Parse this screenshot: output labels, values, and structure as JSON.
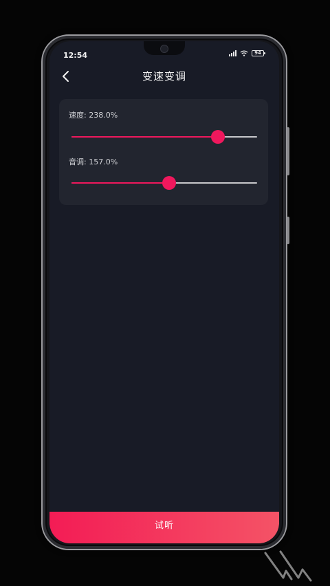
{
  "status_bar": {
    "time": "12:54",
    "battery": "94"
  },
  "header": {
    "title": "变速变调"
  },
  "sliders": [
    {
      "label": "速度: 238.0%",
      "fraction": 0.79
    },
    {
      "label": "音调: 157.0%",
      "fraction": 0.525
    }
  ],
  "footer": {
    "listen_label": "试听"
  },
  "colors": {
    "accent": "#f0185d",
    "screen_bg": "#181b26",
    "card_bg": "#22252f"
  },
  "icons": {
    "back": "chevron-left-icon",
    "signal": "signal-icon",
    "wifi": "wifi-icon",
    "battery": "battery-icon"
  }
}
